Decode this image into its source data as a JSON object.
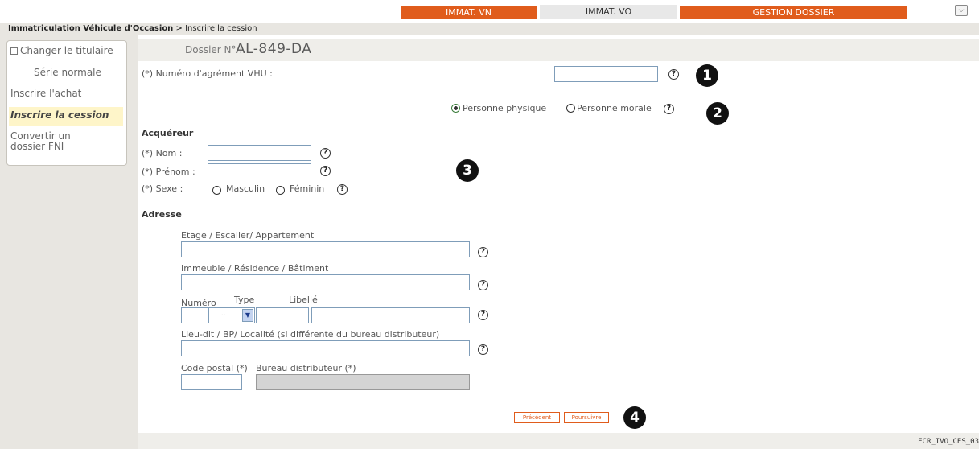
{
  "top_tabs": [
    {
      "label": "IMMAT. VN"
    },
    {
      "label": "IMMAT. VO"
    },
    {
      "label": "GESTION DOSSIER"
    }
  ],
  "expand_icon": "chevron-double-down-icon",
  "breadcrumb": {
    "main": "Immatriculation Véhicule d'Occasion",
    "separator": ">",
    "current": "Inscrire la cession"
  },
  "sidebar": {
    "items": [
      {
        "label": "Changer le titulaire"
      },
      {
        "label": "Série normale"
      },
      {
        "label": "Inscrire l'achat"
      },
      {
        "label": "Inscrire la cession"
      },
      {
        "label": "Convertir un"
      },
      {
        "label": "dossier FNI"
      }
    ]
  },
  "dossier": {
    "label": "Dossier N° :",
    "number": "AL-849-DA"
  },
  "form": {
    "agrement_label": "(*) Numéro d'agrément VHU :",
    "agrement_value": "",
    "personne_physique": "Personne physique",
    "personne_morale": "Personne morale",
    "acquereur_title": "Acquéreur",
    "nom_label": "(*) Nom :",
    "prenom_label": "(*) Prénom :",
    "sexe_label": "(*) Sexe :",
    "masculin": "Masculin",
    "feminin": "Féminin",
    "adresse_title": "Adresse",
    "etage_label": "Etage / Escalier/ Appartement",
    "immeuble_label": "Immeuble / Résidence / Bâtiment",
    "numero_label": "Numéro",
    "type_label": "Type",
    "libelle_label": "Libellé",
    "select_placeholder": "...",
    "lieudit_label": "Lieu-dit / BP/ Localité (si différente du bureau distributeur)",
    "cp_label": "Code postal (*)",
    "bureau_label": "Bureau distributeur (*)",
    "help_symbol": "?"
  },
  "buttons": {
    "precedent": "Précédent",
    "poursuivre": "Poursuivre"
  },
  "badges": [
    "1",
    "2",
    "3",
    "4"
  ],
  "screen_code": "ECR_IVO_CES_03",
  "colors": {
    "accent": "#e05c1c",
    "panel": "#e8e6e1",
    "highlight": "#fef5c9"
  }
}
